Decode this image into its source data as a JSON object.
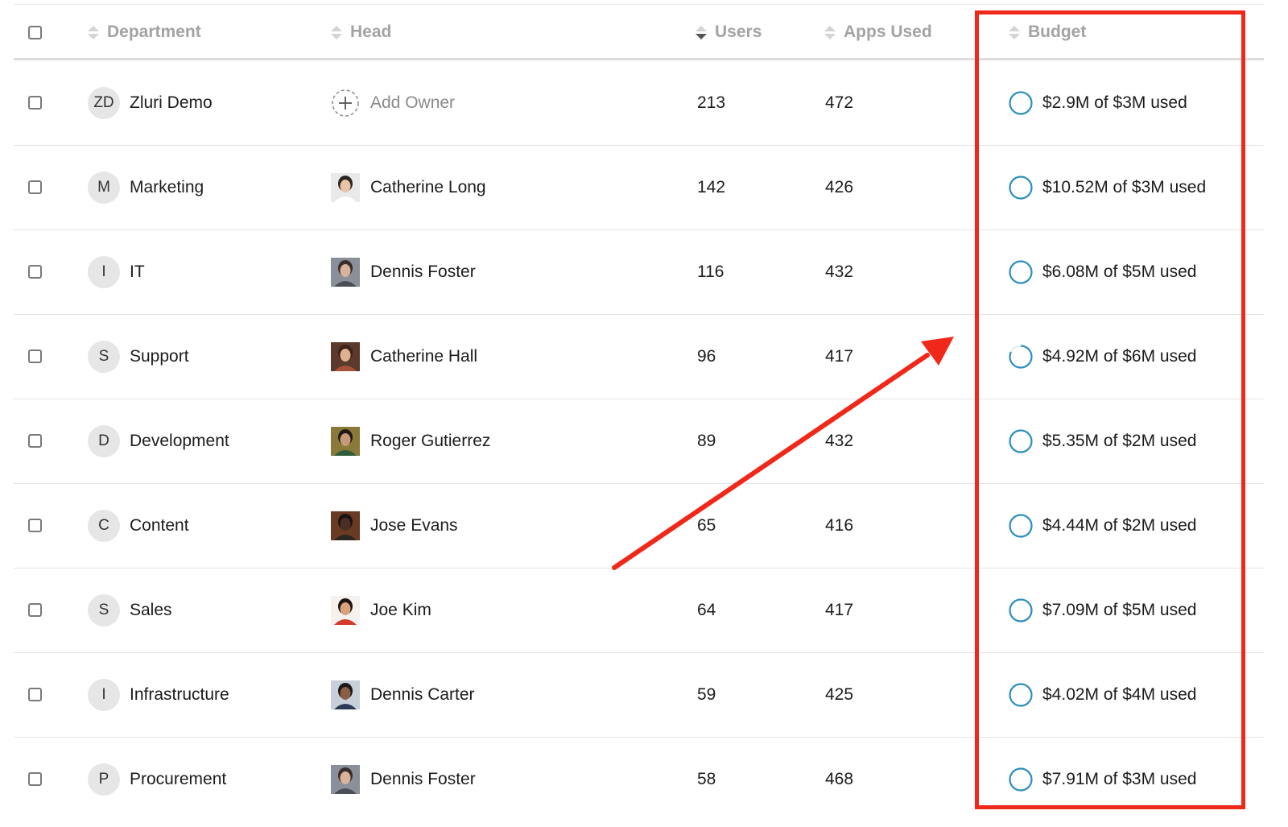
{
  "colors": {
    "accent_ring": "#2c8fbf",
    "annotation_red": "#f0281a",
    "header_text": "#a3a3a3"
  },
  "table": {
    "columns": {
      "department": "Department",
      "head": "Head",
      "users": "Users",
      "apps_used": "Apps Used",
      "budget": "Budget"
    },
    "sorted_column": "users",
    "sort_direction": "descending",
    "rows": [
      {
        "initials": "ZD",
        "department": "Zluri Demo",
        "head": "Add Owner",
        "head_type": "add-owner",
        "users": "213",
        "apps": "472",
        "budget": "$2.9M of $3M used"
      },
      {
        "initials": "M",
        "department": "Marketing",
        "head": "Catherine Long",
        "head_type": "avatar",
        "users": "142",
        "apps": "426",
        "budget": "$10.52M of $3M used"
      },
      {
        "initials": "I",
        "department": "IT",
        "head": "Dennis Foster",
        "head_type": "avatar",
        "users": "116",
        "apps": "432",
        "budget": "$6.08M of $5M used"
      },
      {
        "initials": "S",
        "department": "Support",
        "head": "Catherine Hall",
        "head_type": "avatar",
        "users": "96",
        "apps": "417",
        "budget": "$4.92M of $6M used"
      },
      {
        "initials": "D",
        "department": "Development",
        "head": "Roger Gutierrez",
        "head_type": "avatar",
        "users": "89",
        "apps": "432",
        "budget": "$5.35M of $2M used"
      },
      {
        "initials": "C",
        "department": "Content",
        "head": "Jose Evans",
        "head_type": "avatar",
        "users": "65",
        "apps": "416",
        "budget": "$4.44M of $2M used"
      },
      {
        "initials": "S",
        "department": "Sales",
        "head": "Joe Kim",
        "head_type": "avatar",
        "users": "64",
        "apps": "417",
        "budget": "$7.09M of $5M used"
      },
      {
        "initials": "I",
        "department": "Infrastructure",
        "head": "Dennis Carter",
        "head_type": "avatar",
        "users": "59",
        "apps": "425",
        "budget": "$4.02M of $4M used"
      },
      {
        "initials": "P",
        "department": "Procurement",
        "head": "Dennis Foster",
        "head_type": "avatar",
        "users": "58",
        "apps": "468",
        "budget": "$7.91M of $3M used"
      }
    ]
  },
  "avatars": [
    {
      "bg": "#e9e9e9",
      "hair": "#2b2420",
      "skin": "#e8c3a6",
      "shirt": "#ffffff"
    },
    {
      "bg": "#8a8f99",
      "hair": "#3a2e28",
      "skin": "#d9b39a",
      "shirt": "#4a4f57"
    },
    {
      "bg": "#5a3a2c",
      "hair": "#3b2316",
      "skin": "#e0b090",
      "shirt": "#a8523a"
    },
    {
      "bg": "#8a7a3a",
      "hair": "#1f1a16",
      "skin": "#c99a78",
      "shirt": "#2f5c3a"
    },
    {
      "bg": "#6a3a22",
      "hair": "#1b1412",
      "skin": "#4a3024",
      "shirt": "#2a2622"
    },
    {
      "bg": "#f5f1ee",
      "hair": "#1d1613",
      "skin": "#d9a27c",
      "shirt": "#d23b2b"
    },
    {
      "bg": "#c7cfd8",
      "hair": "#1c1815",
      "skin": "#8a5e45",
      "shirt": "#2c3a56"
    },
    {
      "bg": "#8a8f99",
      "hair": "#3a2e28",
      "skin": "#d9b39a",
      "shirt": "#4a4f57"
    }
  ],
  "budget_progress": [
    1,
    1,
    1,
    0.82,
    1,
    1,
    1,
    1,
    1
  ]
}
